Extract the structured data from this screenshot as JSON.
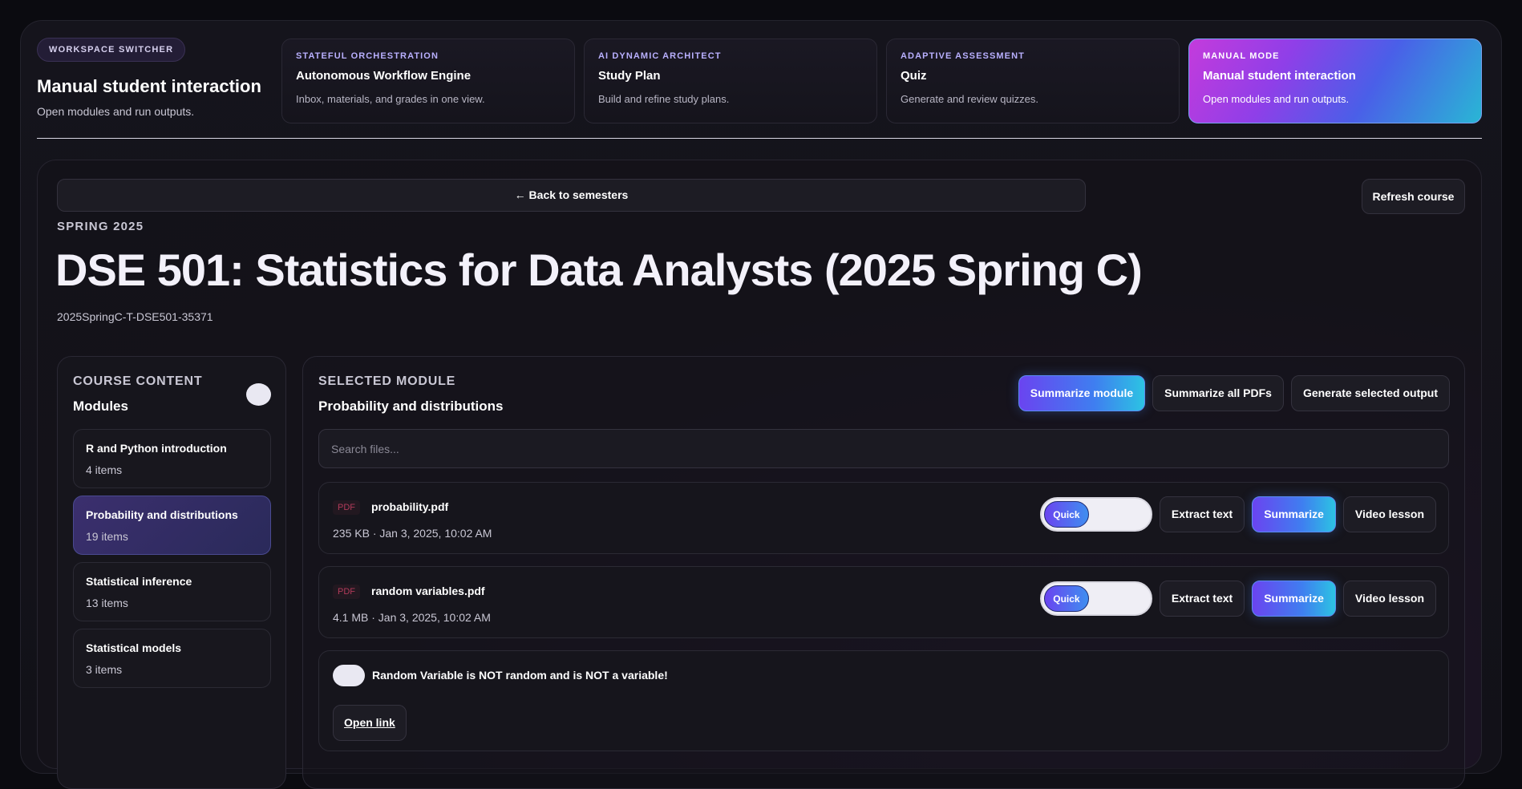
{
  "workspace": {
    "pill": "WORKSPACE SWITCHER",
    "title": "Manual student interaction",
    "subtitle": "Open modules and run outputs.",
    "cards": [
      {
        "kicker": "STATEFUL ORCHESTRATION",
        "title": "Autonomous Workflow Engine",
        "desc": "Inbox, materials, and grades in one view."
      },
      {
        "kicker": "AI DYNAMIC ARCHITECT",
        "title": "Study Plan",
        "desc": "Build and refine study plans."
      },
      {
        "kicker": "ADAPTIVE ASSESSMENT",
        "title": "Quiz",
        "desc": "Generate and review quizzes."
      },
      {
        "kicker": "MANUAL MODE",
        "title": "Manual student interaction",
        "desc": "Open modules and run outputs."
      }
    ]
  },
  "course": {
    "back_label": "← Back to semesters",
    "refresh_label": "Refresh course",
    "semester": "SPRING 2025",
    "title": "DSE 501: Statistics for Data Analysts (2025 Spring C)",
    "code": "2025SpringC-T-DSE501-35371"
  },
  "sidebar": {
    "kicker": "COURSE CONTENT",
    "title": "Modules",
    "modules": [
      {
        "name": "R and Python introduction",
        "count": "4 items"
      },
      {
        "name": "Probability and distributions",
        "count": "19 items"
      },
      {
        "name": "Statistical inference",
        "count": "13 items"
      },
      {
        "name": "Statistical models",
        "count": "3 items"
      }
    ]
  },
  "module": {
    "kicker": "SELECTED MODULE",
    "title": "Probability and distributions",
    "actions": {
      "summarize_module": "Summarize module",
      "summarize_all": "Summarize all PDFs",
      "generate": "Generate selected output"
    },
    "search_placeholder": "Search files...",
    "files": [
      {
        "badge": "PDF",
        "name": "probability.pdf",
        "meta": "235 KB · Jan 3, 2025, 10:02 AM",
        "mode": "Quick",
        "extract": "Extract text",
        "summarize": "Summarize",
        "video": "Video lesson"
      },
      {
        "badge": "PDF",
        "name": "random variables.pdf",
        "meta": "4.1 MB · Jan 3, 2025, 10:02 AM",
        "mode": "Quick",
        "extract": "Extract text",
        "summarize": "Summarize",
        "video": "Video lesson"
      }
    ],
    "link_item": {
      "title": "Random Variable is NOT random and is NOT a variable!",
      "button": "Open link"
    }
  },
  "colors": {
    "accent_start": "#6a44f0",
    "accent_end": "#2cc3e3",
    "active_card_start": "#c43bdc",
    "background": "#0b0b10"
  }
}
